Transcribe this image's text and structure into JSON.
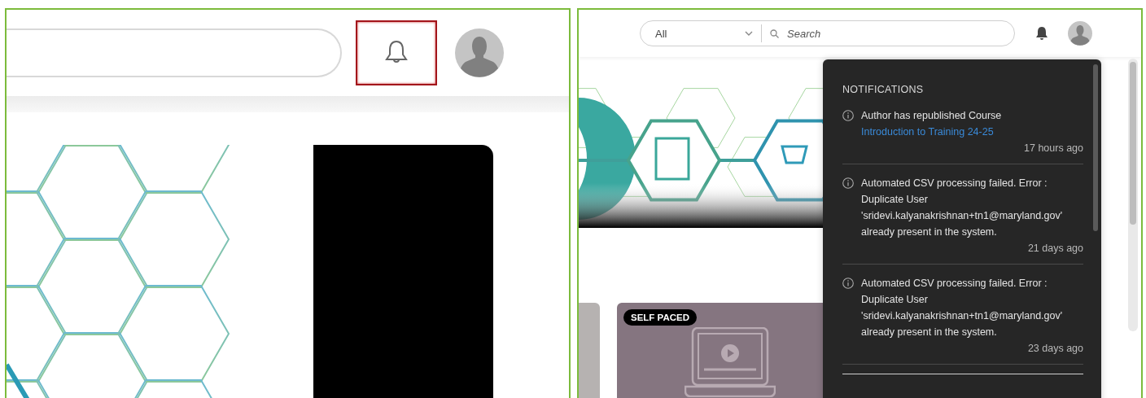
{
  "left_view": {
    "notifications_button": {
      "highlighted": true
    }
  },
  "right_view": {
    "search": {
      "scope": "All",
      "placeholder": "Search"
    },
    "notifications": {
      "title": "NOTIFICATIONS",
      "items": [
        {
          "text": "Author has republished Course ",
          "link": "Introduction to Training 24-25",
          "time": "17 hours ago"
        },
        {
          "text": "Automated CSV processing failed. Error : Duplicate User 'sridevi.kalyanakrishnan+tn1@maryland.gov' already present in the system.",
          "time": "21 days ago"
        },
        {
          "text": "Automated CSV processing failed. Error : Duplicate User 'sridevi.kalyanakrishnan+tn1@maryland.gov' already present in the system.",
          "time": "23 days ago"
        }
      ]
    },
    "course_card": {
      "badge": "SELF PACED"
    }
  }
}
